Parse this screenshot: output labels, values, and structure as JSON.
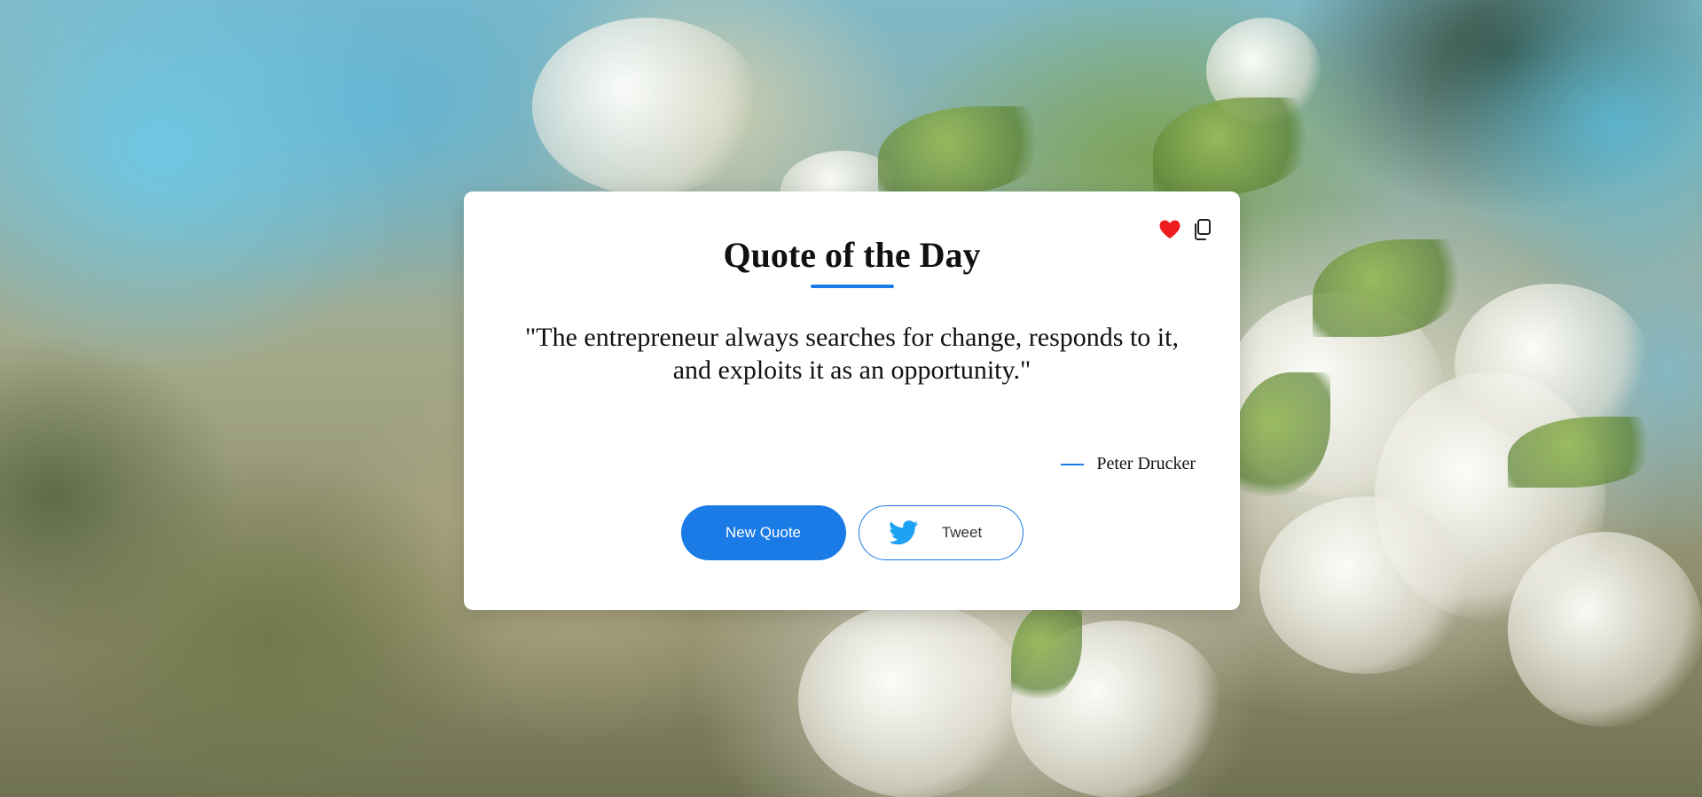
{
  "colors": {
    "accent": "#1a7be6",
    "heart": "#ee1c1c",
    "twitter": "#1da1f2",
    "card_bg": "#ffffff",
    "text": "#111111"
  },
  "card": {
    "title": "Quote of the Day",
    "quote": "\"The entrepreneur always searches for change, responds to it, and exploits it as an opportunity.\"",
    "author": "Peter Drucker",
    "icons": {
      "favorite": "heart-icon",
      "copy": "copy-icon",
      "tweet": "twitter-bird-icon"
    }
  },
  "buttons": {
    "new_quote_label": "New Quote",
    "tweet_label": "Tweet"
  }
}
